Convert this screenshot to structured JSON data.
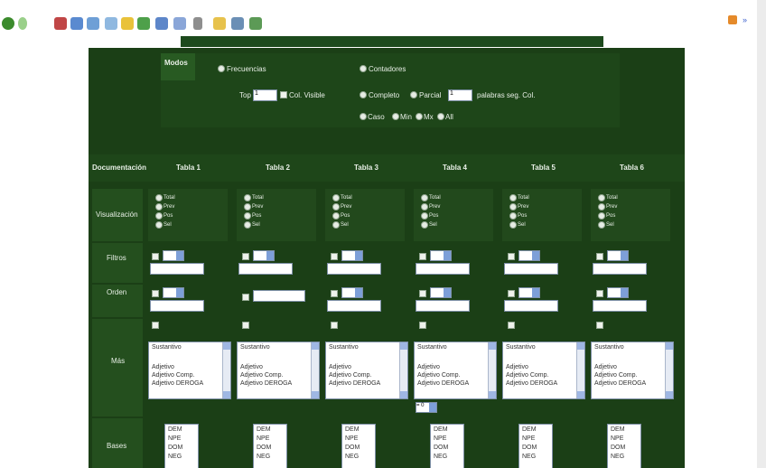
{
  "browser": {
    "toolbar_icons": [
      "back-icon",
      "forward-icon",
      "stop-icon",
      "refresh-icon",
      "home-icon",
      "search-icon",
      "favorites-icon",
      "media-icon",
      "history-icon",
      "mail-icon",
      "print-icon",
      "edit-icon",
      "folder-icon",
      "discuss-icon",
      "messenger-icon"
    ]
  },
  "form": {
    "section_label": "Modos",
    "mode_options": [
      "Frecuencias",
      "Contadores"
    ],
    "top_n_label": "Top",
    "top_n_value": "1",
    "col_option": "Col. Visible",
    "complete_label": "Completo",
    "partial_label": "Parcial",
    "partial_value": "1",
    "partial_suffix": "palabras seg. Col.",
    "case_options": [
      "Caso",
      "Min",
      "Mx",
      "All"
    ]
  },
  "grid": {
    "corner_label": "Documentación",
    "tables": [
      "Tabla 1",
      "Tabla 2",
      "Tabla 3",
      "Tabla 4",
      "Tabla 5",
      "Tabla 6"
    ],
    "row_labels": {
      "display": "Visualización",
      "filter": "Filtros",
      "order": "Orden",
      "lists": "Más",
      "fields": "Bases"
    },
    "display_options": [
      "Total",
      "Prev",
      "Pos",
      "Sel"
    ],
    "list_items": [
      "Sustantivo",
      "Adjetivo",
      "Adjetivo Comp.",
      "Adjetivo DEROGA"
    ],
    "field_items": [
      "DEM",
      "NPE",
      "DOM",
      "NEG"
    ],
    "select_value": "= 0"
  },
  "colors": {
    "panel": "#1b3f16",
    "cell": "#244f1e",
    "topbar": "#1d4a1d"
  }
}
